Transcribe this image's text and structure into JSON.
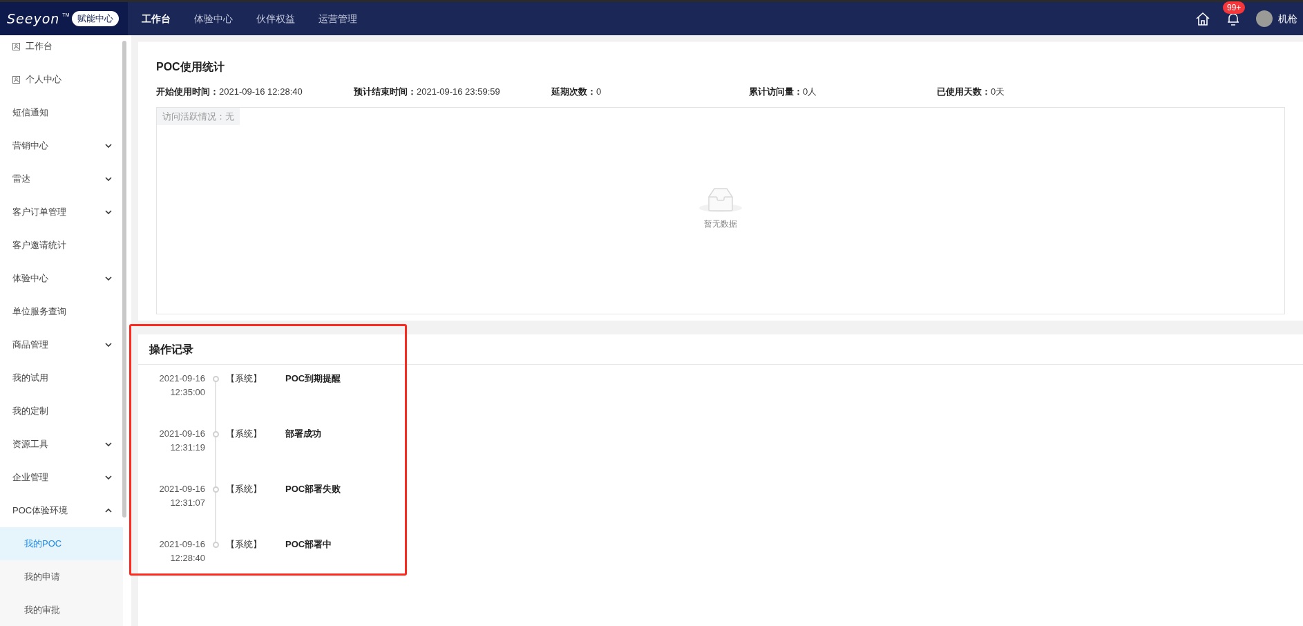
{
  "header": {
    "logo": {
      "wordmark": "Seeyon",
      "tm": "TM",
      "badge": "赋能中心"
    },
    "nav": [
      {
        "label": "工作台",
        "selected": true
      },
      {
        "label": "体验中心",
        "selected": false
      },
      {
        "label": "伙伴权益",
        "selected": false
      },
      {
        "label": "运营管理",
        "selected": false
      }
    ],
    "notifications": {
      "count": "99+"
    },
    "user": {
      "name": "机枪"
    }
  },
  "sidebar": {
    "items": [
      {
        "label": "工作台",
        "kind": "icon",
        "selected": false
      },
      {
        "label": "个人中心",
        "kind": "icon",
        "selected": false
      },
      {
        "label": "短信通知",
        "kind": "plain",
        "selected": false
      },
      {
        "label": "营销中心",
        "kind": "group",
        "expanded": false,
        "selected": false
      },
      {
        "label": "雷达",
        "kind": "group",
        "expanded": false,
        "selected": false
      },
      {
        "label": "客户订单管理",
        "kind": "group",
        "expanded": false,
        "selected": false
      },
      {
        "label": "客户邀请统计",
        "kind": "plain",
        "selected": false
      },
      {
        "label": "体验中心",
        "kind": "group",
        "expanded": false,
        "selected": false
      },
      {
        "label": "单位服务查询",
        "kind": "plain",
        "selected": false
      },
      {
        "label": "商品管理",
        "kind": "group",
        "expanded": false,
        "selected": false
      },
      {
        "label": "我的试用",
        "kind": "plain",
        "selected": false
      },
      {
        "label": "我的定制",
        "kind": "plain",
        "selected": false
      },
      {
        "label": "资源工具",
        "kind": "group",
        "expanded": false,
        "selected": false
      },
      {
        "label": "企业管理",
        "kind": "group",
        "expanded": false,
        "selected": false
      },
      {
        "label": "POC体验环境",
        "kind": "group",
        "expanded": true,
        "selected": false,
        "children": [
          {
            "label": "我的POC",
            "selected": true
          },
          {
            "label": "我的申请",
            "selected": false
          },
          {
            "label": "我的审批",
            "selected": false
          }
        ]
      }
    ]
  },
  "poc_stats": {
    "title": "POC使用统计",
    "fields": [
      {
        "label": "开始使用时间：",
        "value": "2021-09-16 12:28:40"
      },
      {
        "label": "预计结束时间：",
        "value": "2021-09-16 23:59:59"
      },
      {
        "label": "延期次数：",
        "value": "0"
      },
      {
        "label": "累计访问量：",
        "value": "0人"
      },
      {
        "label": "已使用天数：",
        "value": "0天"
      }
    ],
    "activity": {
      "label": "访问活跃情况：无",
      "empty_text": "暂无数据"
    }
  },
  "operation_log": {
    "title": "操作记录",
    "entries": [
      {
        "date": "2021-09-16",
        "time": "12:35:00",
        "source": "【系统】",
        "event": "POC到期提醒"
      },
      {
        "date": "2021-09-16",
        "time": "12:31:19",
        "source": "【系统】",
        "event": "部署成功"
      },
      {
        "date": "2021-09-16",
        "time": "12:31:07",
        "source": "【系统】",
        "event": "POC部署失败"
      },
      {
        "date": "2021-09-16",
        "time": "12:28:40",
        "source": "【系统】",
        "event": "POC部署中"
      }
    ]
  }
}
